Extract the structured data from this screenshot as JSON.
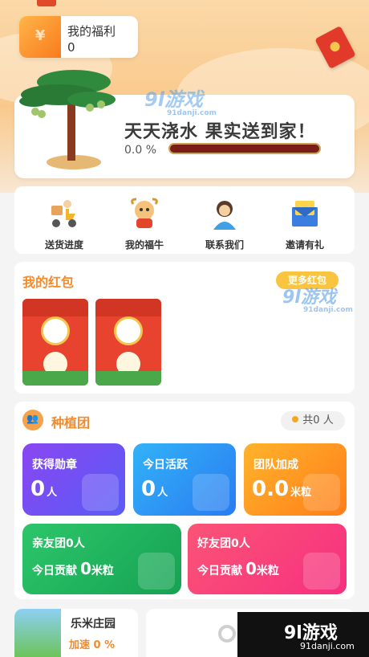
{
  "welfare": {
    "title": "我的福利",
    "value": "0"
  },
  "hero": {
    "slogan": "天天浇水 果实送到家！",
    "progress_text": "0.0 %",
    "progress_fraction": 0.0
  },
  "menu": [
    {
      "label": "送货进度",
      "icon": "delivery-scooter-icon"
    },
    {
      "label": "我的福牛",
      "icon": "lucky-ox-icon"
    },
    {
      "label": "联系我们",
      "icon": "customer-service-icon"
    },
    {
      "label": "邀请有礼",
      "icon": "invite-envelope-icon"
    }
  ],
  "red_packets": {
    "title": "我的红包",
    "more_label": "更多红包",
    "count": 2
  },
  "team": {
    "title": "种植团",
    "total_prefix": "共",
    "total_value": "0",
    "total_unit": "人",
    "stats": [
      {
        "label": "获得勋章",
        "value": "0",
        "unit": "人"
      },
      {
        "label": "今日活跃",
        "value": "0",
        "unit": "人"
      },
      {
        "label": "团队加成",
        "value": "0.0",
        "unit": "米粒"
      }
    ],
    "groups": [
      {
        "label": "亲友团0人",
        "contrib_label": "今日贡献",
        "contrib_value": "0",
        "contrib_unit": "米粒"
      },
      {
        "label": "好友团0人",
        "contrib_label": "今日贡献",
        "contrib_value": "0",
        "contrib_unit": "米粒"
      }
    ]
  },
  "farm": {
    "title": "乐米庄园",
    "speed": "加速 0 %"
  },
  "watermark": {
    "logo": "9l游戏",
    "url": "91danji.com",
    "url_small": "91danji.com"
  },
  "colors": {
    "accent": "#f58a2a",
    "progress_track": "#7a1d17",
    "progress_fill": "#f0a52e"
  }
}
